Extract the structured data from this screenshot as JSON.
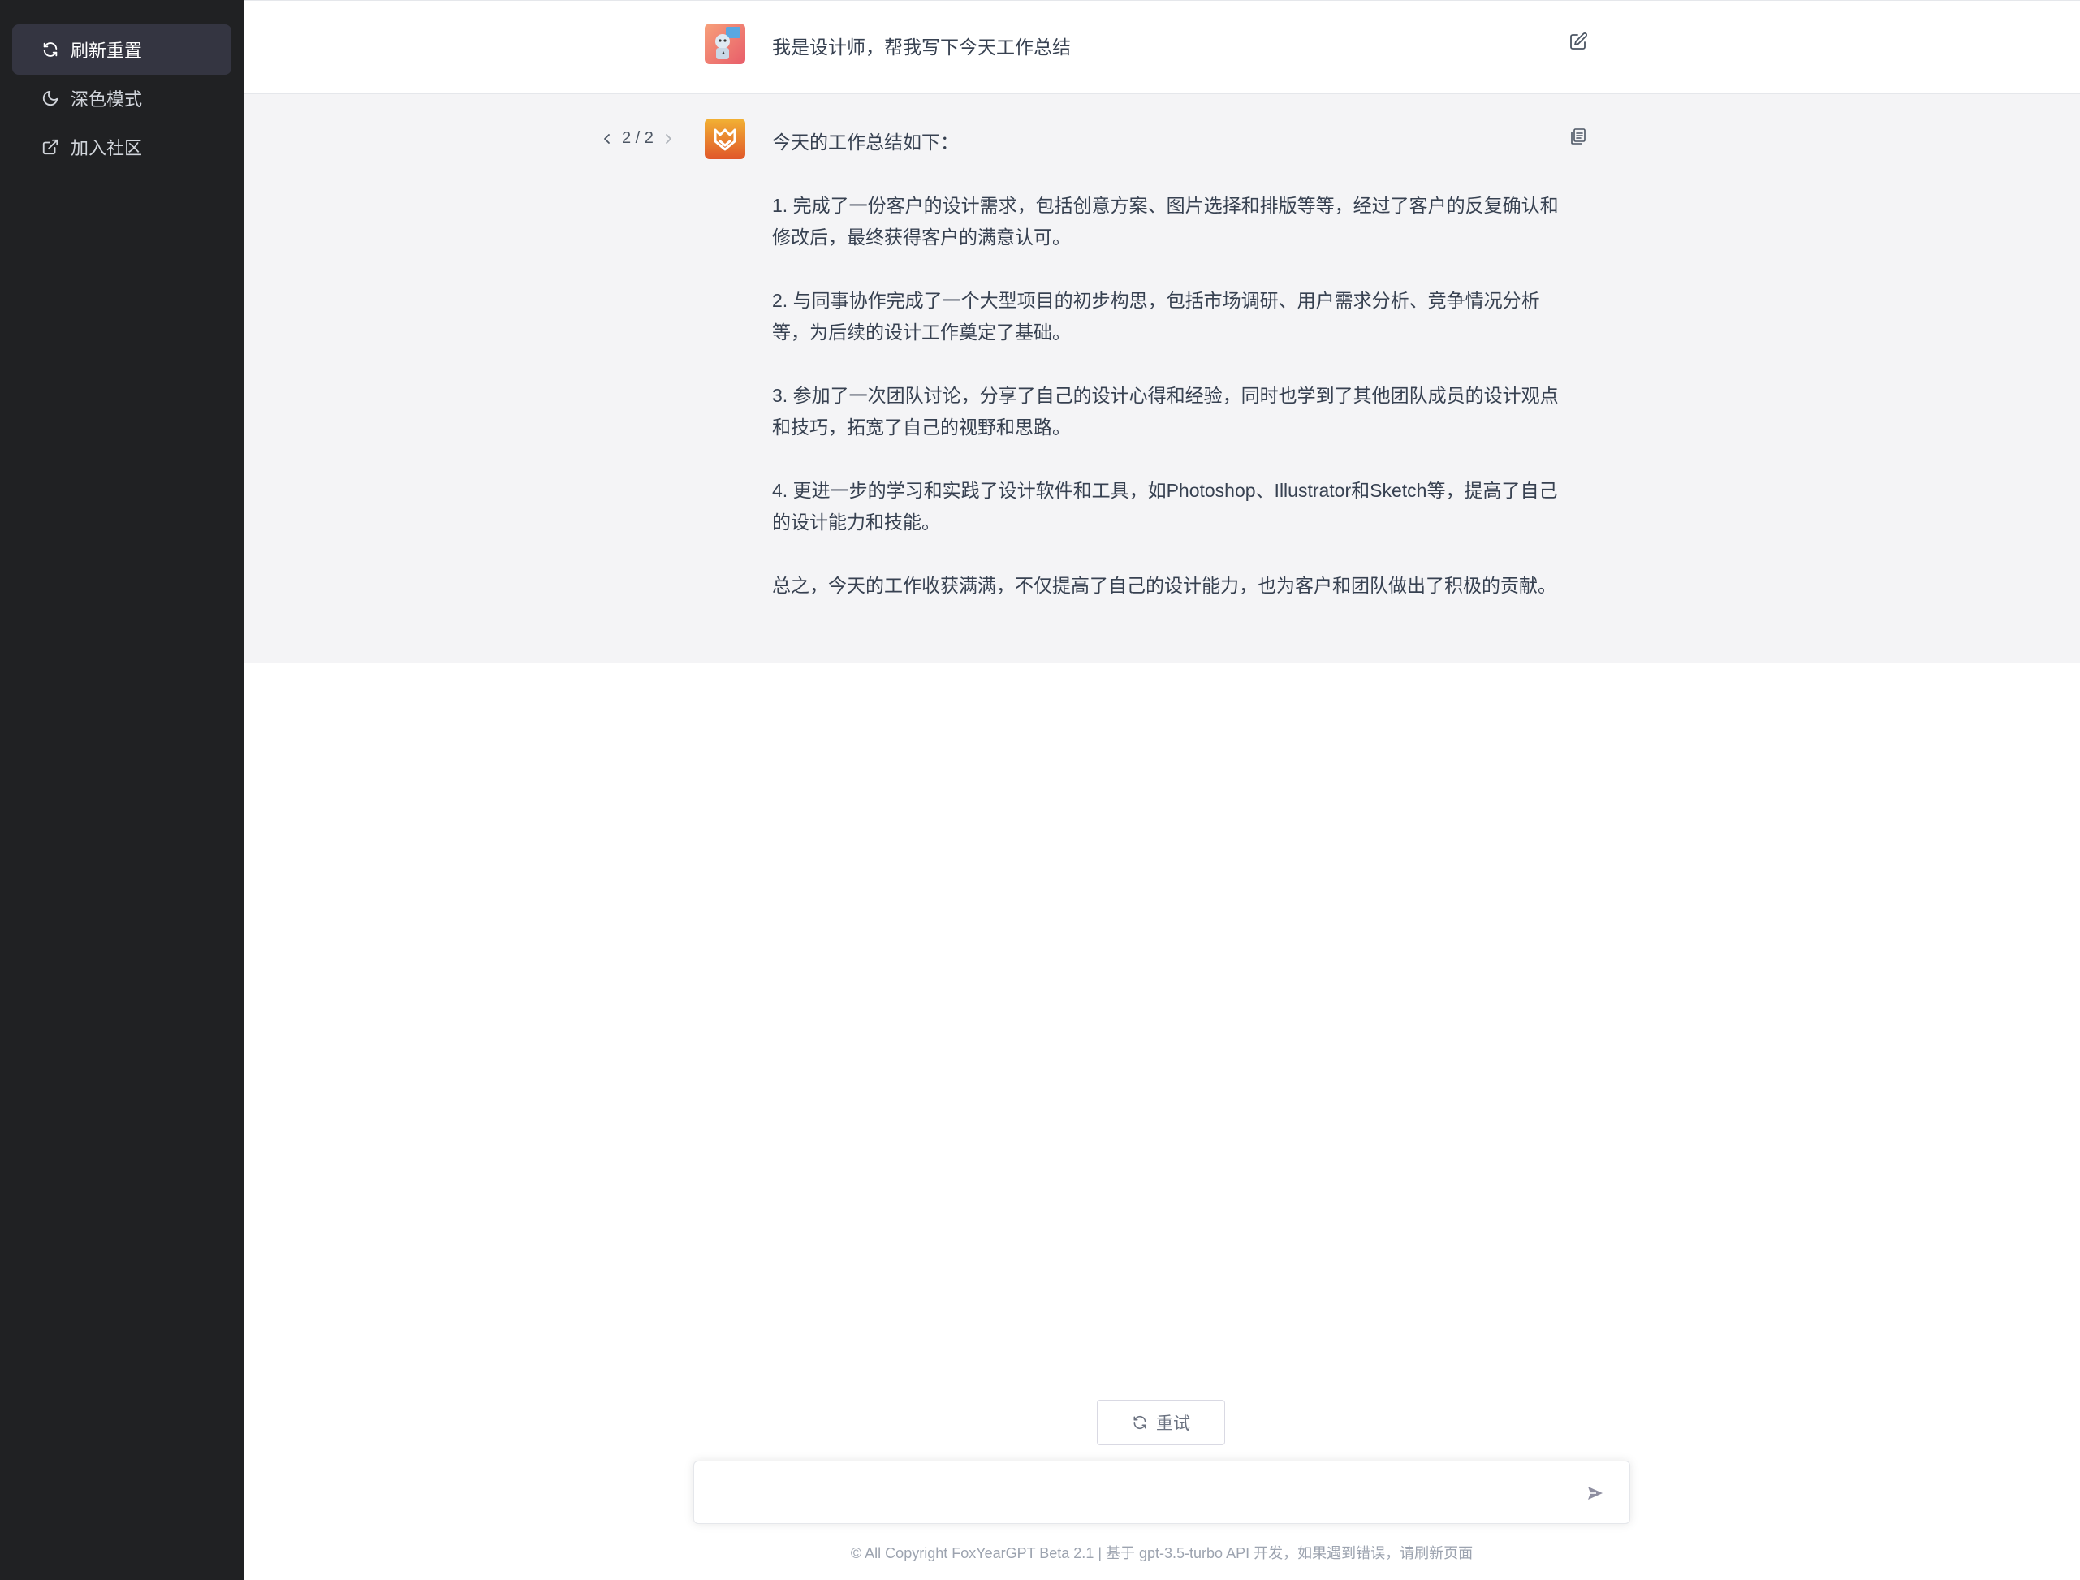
{
  "sidebar": {
    "items": [
      {
        "label": "刷新重置",
        "icon": "refresh-icon",
        "active": true
      },
      {
        "label": "深色模式",
        "icon": "moon-icon",
        "active": false
      },
      {
        "label": "加入社区",
        "icon": "external-link-icon",
        "active": false
      }
    ]
  },
  "conversation": {
    "user_message": "我是设计师，帮我写下今天工作总结",
    "assistant_pager": "2 / 2",
    "assistant_paragraphs": [
      "今天的工作总结如下：",
      "1. 完成了一份客户的设计需求，包括创意方案、图片选择和排版等等，经过了客户的反复确认和修改后，最终获得客户的满意认可。",
      "2. 与同事协作完成了一个大型项目的初步构思，包括市场调研、用户需求分析、竞争情况分析等，为后续的设计工作奠定了基础。",
      "3. 参加了一次团队讨论，分享了自己的设计心得和经验，同时也学到了其他团队成员的设计观点和技巧，拓宽了自己的视野和思路。",
      "4. 更进一步的学习和实践了设计软件和工具，如Photoshop、Illustrator和Sketch等，提高了自己的设计能力和技能。",
      "总之，今天的工作收获满满，不仅提高了自己的设计能力，也为客户和团队做出了积极的贡献。"
    ]
  },
  "composer": {
    "retry_label": "重试",
    "input_value": "",
    "input_placeholder": ""
  },
  "footer": {
    "copyright": "© All Copyright FoxYearGPT Beta 2.1 | 基于 gpt-3.5-turbo API 开发，如果遇到错误，请刷新页面"
  },
  "colors": {
    "sidebar_bg": "#202123",
    "sidebar_active": "#343541",
    "assistant_bg": "#f4f4f6",
    "user_avatar": "#f06a5a",
    "assistant_avatar": "#e8842c"
  }
}
